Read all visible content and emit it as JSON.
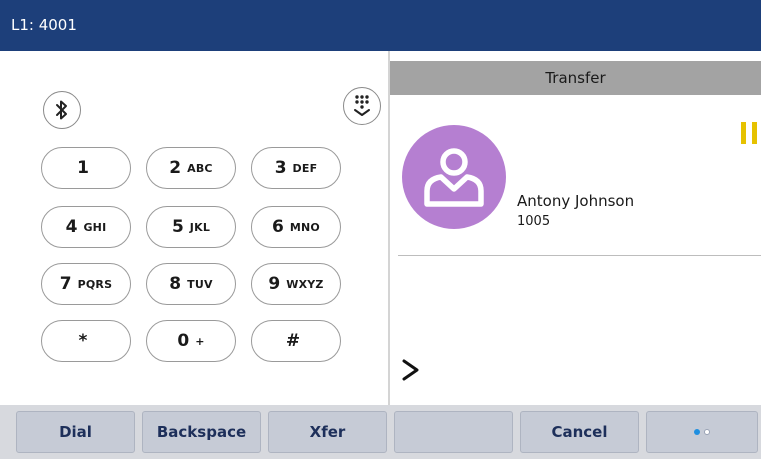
{
  "titlebar": {
    "line": "L1: 4001"
  },
  "keypad": {
    "keys": [
      {
        "digit": "1",
        "letters": ""
      },
      {
        "digit": "2",
        "letters": "ABC"
      },
      {
        "digit": "3",
        "letters": "DEF"
      },
      {
        "digit": "4",
        "letters": "GHI"
      },
      {
        "digit": "5",
        "letters": "JKL"
      },
      {
        "digit": "6",
        "letters": "MNO"
      },
      {
        "digit": "7",
        "letters": "PQRS"
      },
      {
        "digit": "8",
        "letters": "TUV"
      },
      {
        "digit": "9",
        "letters": "WXYZ"
      },
      {
        "digit": "*",
        "letters": ""
      },
      {
        "digit": "0",
        "letters": "+"
      },
      {
        "digit": "#",
        "letters": ""
      }
    ],
    "bluetooth_icon": "bluetooth-icon",
    "hide_keypad_icon": "keypad-collapse-icon"
  },
  "panel": {
    "header": "Transfer",
    "contact": {
      "name": "Antony Johnson",
      "number": "1005"
    },
    "status_icon": "hold-icon",
    "expand_icon": "chevron-right-icon"
  },
  "softkeys": [
    {
      "label": "Dial"
    },
    {
      "label": "Backspace"
    },
    {
      "label": "Xfer"
    },
    {
      "label": ""
    },
    {
      "label": "Cancel"
    }
  ],
  "pager": {
    "total": 2,
    "current": 1
  },
  "colors": {
    "titlebar": "#1d3f7a",
    "avatar": "#b57fd1",
    "hold": "#e6c200",
    "pager_active": "#1f8fe0"
  }
}
